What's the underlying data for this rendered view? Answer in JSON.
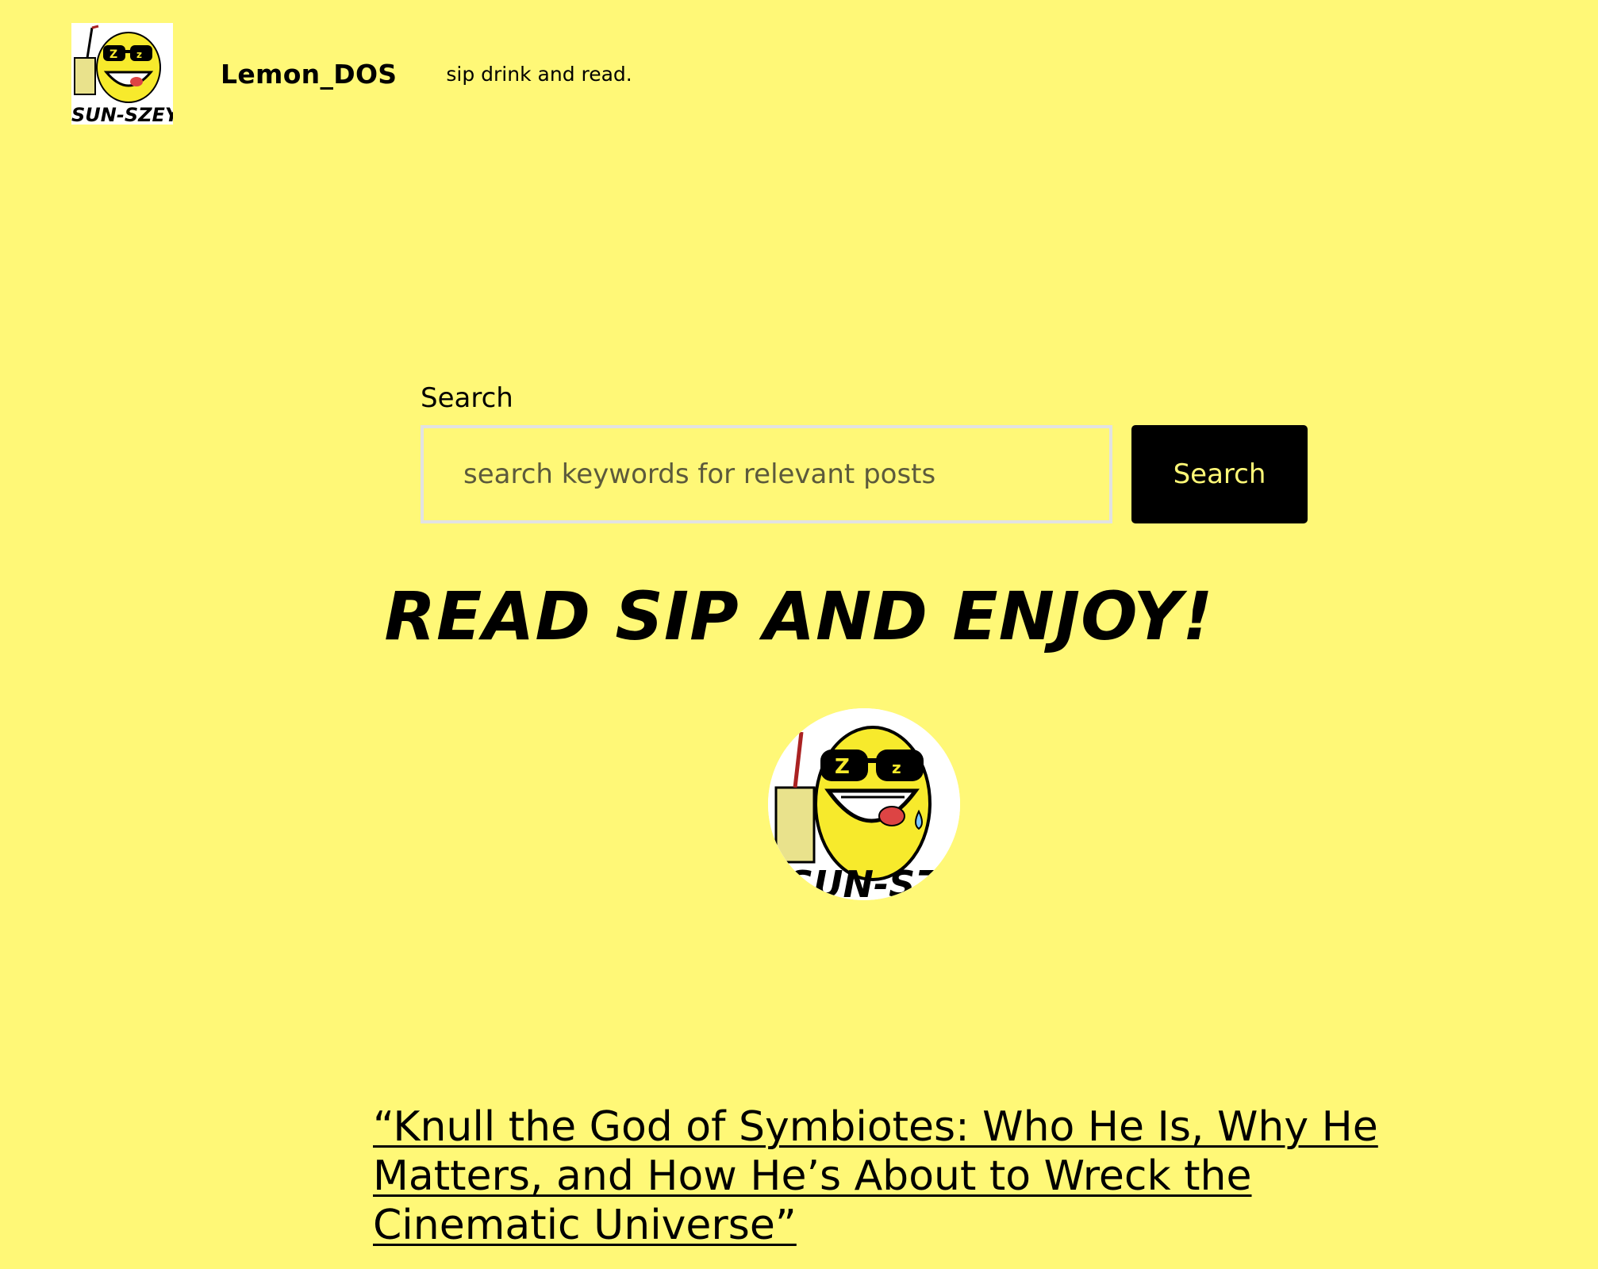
{
  "header": {
    "site_title": "Lemon_DOS",
    "tagline": "sip drink and read.",
    "logo_icon": "lemon-mascot-icon",
    "logo_text": "SUN-SZEY"
  },
  "search": {
    "label": "Search",
    "placeholder": "search keywords for relevant posts",
    "button_label": "Search"
  },
  "hero": {
    "headline": "READ SIP AND ENJOY!",
    "avatar_icon": "lemon-mascot-icon"
  },
  "post": {
    "title": "“Knull the God of Symbiotes: Who He Is, Why He Matters, and How He’s About to Wreck the Cinematic Universe”"
  },
  "colors": {
    "background": "#fff877",
    "button_bg": "#000000",
    "button_text": "#fff877",
    "lemon": "#f7ea2c"
  }
}
